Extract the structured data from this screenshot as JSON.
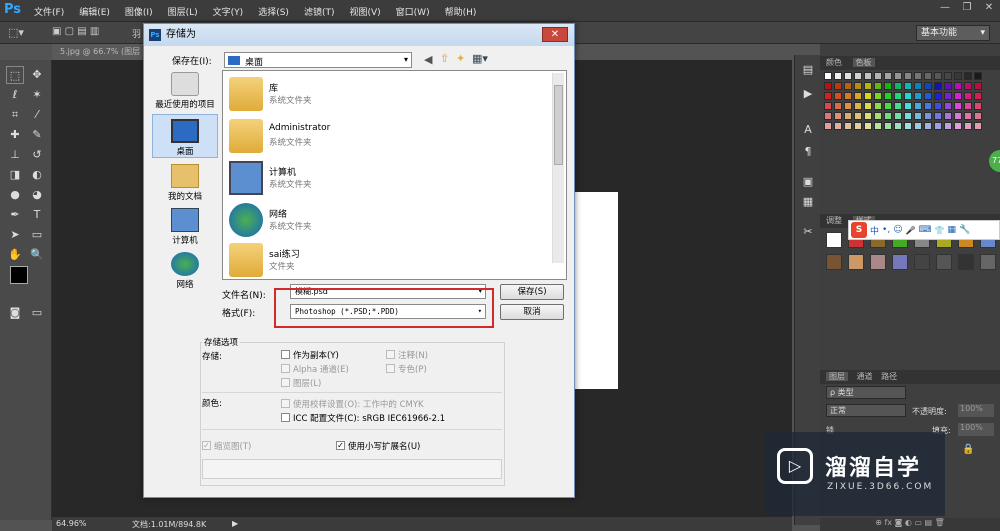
{
  "app": {
    "logo": "Ps",
    "menus": [
      "文件(F)",
      "编辑(E)",
      "图像(I)",
      "图层(L)",
      "文字(Y)",
      "选择(S)",
      "滤镜(T)",
      "视图(V)",
      "窗口(W)",
      "帮助(H)"
    ],
    "workspace": "基本功能",
    "doc_tab": "5.jpg @ 66.7% (图层",
    "zoom": "64.96%",
    "doc_info": "文档:1.01M/894.8K",
    "opt_label": "羽"
  },
  "panels": {
    "color_tab": "颜色",
    "swatches_tab": "色板",
    "adjust_tab": "调整",
    "styles_tab": "样式",
    "layers_tab": "图层",
    "channels_tab": "通道",
    "paths_tab": "路径",
    "kind": "ρ 类型",
    "blend": "正常",
    "opacity_label": "不透明度:",
    "opacity": "100%",
    "lock_label": "锁",
    "fill_label": "填充:",
    "fill": "100%",
    "badge": "77"
  },
  "ime": {
    "items": [
      "中",
      "•,",
      "☺",
      "🎤",
      "⌨",
      "👕",
      "▦",
      "🔧"
    ]
  },
  "dialog": {
    "title": "存储为",
    "save_in_label": "保存在(I):",
    "save_in_value": "桌面",
    "places": [
      "最近使用的项目",
      "桌面",
      "我的文档",
      "计算机",
      "网络"
    ],
    "files": [
      {
        "name": "库",
        "type": "系统文件夹"
      },
      {
        "name": "Administrator",
        "type": "系统文件夹"
      },
      {
        "name": "计算机",
        "type": "系统文件夹"
      },
      {
        "name": "网络",
        "type": "系统文件夹"
      },
      {
        "name": "sai练习",
        "type": "文件夹"
      }
    ],
    "filename_label": "文件名(N):",
    "filename_value": "模糊.psd",
    "format_label": "格式(F):",
    "format_value": "Photoshop (*.PSD;*.PDD)",
    "save_btn": "保存(S)",
    "cancel_btn": "取消",
    "opts_title": "存储选项",
    "store_label": "存储:",
    "as_copy": "作为副本(Y)",
    "alpha": "Alpha 通道(E)",
    "layers": "图层(L)",
    "notes": "注释(N)",
    "spot": "专色(P)",
    "color_label": "颜色:",
    "proof": "使用校样设置(O): 工作中的 CMYK",
    "icc": "ICC 配置文件(C): sRGB IEC61966-2.1",
    "thumb": "缩览图(T)",
    "lower_ext": "使用小写扩展名(U)"
  },
  "watermark": {
    "title": "溜溜自学",
    "url": "ZIXUE.3D66.COM"
  },
  "colors": {
    "red_highlight": "#d22a2a",
    "ps_blue": "#31a8ff"
  }
}
